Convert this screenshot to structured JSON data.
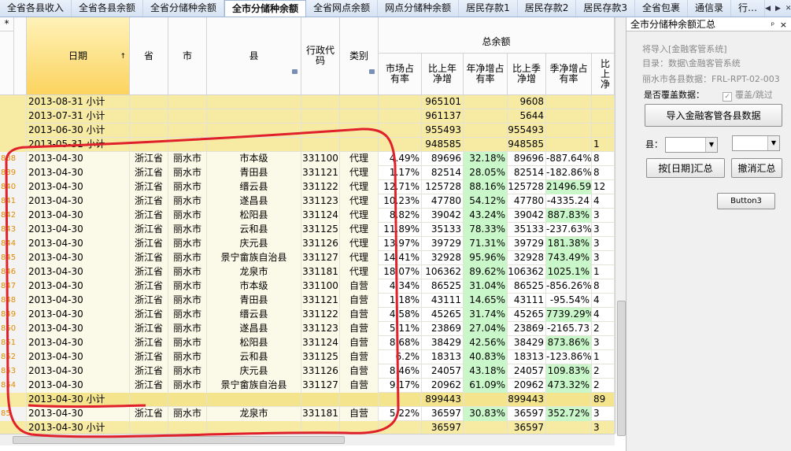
{
  "tabs": [
    "全省各县收入",
    "全省各县余额",
    "全省分储种余额",
    "全市分储种余额",
    "全省网点余额",
    "网点分储种余额",
    "居民存款1",
    "居民存款2",
    "居民存款3",
    "全省包裹",
    "通信录",
    "行…"
  ],
  "active_tab": "全市分储种余额",
  "grid": {
    "star": "*",
    "headers": {
      "date": "日期",
      "date_sort": "↑",
      "province": "省",
      "city": "市",
      "county": "县",
      "code": "行政代码",
      "type": "类别",
      "group": "总余额",
      "c1": "市场占有率",
      "c2": "比上年净增",
      "c3": "年净增占有率",
      "c4": "比上季净增",
      "c5": "季净增占有率",
      "c6": "比上净"
    },
    "rows": [
      {
        "idx": "",
        "date": "2013-08-31 小计",
        "prov": "",
        "city": "",
        "county": "",
        "code": "",
        "type": "",
        "c1": "",
        "c2": "965101",
        "c3": "",
        "c4": "9608",
        "c5": "",
        "c6": "",
        "kind": "sub"
      },
      {
        "idx": "",
        "date": "2013-07-31 小计",
        "prov": "",
        "city": "",
        "county": "",
        "code": "",
        "type": "",
        "c1": "",
        "c2": "961137",
        "c3": "",
        "c4": "5644",
        "c5": "",
        "c6": "",
        "kind": "sub"
      },
      {
        "idx": "",
        "date": "2013-06-30 小计",
        "prov": "",
        "city": "",
        "county": "",
        "code": "",
        "type": "",
        "c1": "",
        "c2": "955493",
        "c3": "",
        "c4": "955493",
        "c5": "",
        "c6": "",
        "kind": "sub"
      },
      {
        "idx": "",
        "date": "2013-05-31 小计",
        "prov": "",
        "city": "",
        "county": "",
        "code": "",
        "type": "",
        "c1": "",
        "c2": "948585",
        "c3": "",
        "c4": "948585",
        "c5": "",
        "c6": "1",
        "kind": "sub"
      },
      {
        "idx": "838",
        "date": "2013-04-30",
        "prov": "浙江省",
        "city": "丽水市",
        "county": "市本级",
        "code": "331100",
        "type": "代理",
        "c1": "4.49%",
        "c2": "89696",
        "c3": "32.18%",
        "c4": "89696",
        "c5": "-887.64%",
        "c6": "8",
        "kind": "data",
        "g3": true
      },
      {
        "idx": "839",
        "date": "2013-04-30",
        "prov": "浙江省",
        "city": "丽水市",
        "county": "青田县",
        "code": "331121",
        "type": "代理",
        "c1": "1.17%",
        "c2": "82514",
        "c3": "28.05%",
        "c4": "82514",
        "c5": "-182.86%",
        "c6": "8",
        "kind": "data",
        "g3": true
      },
      {
        "idx": "840",
        "date": "2013-04-30",
        "prov": "浙江省",
        "city": "丽水市",
        "county": "缙云县",
        "code": "331122",
        "type": "代理",
        "c1": "12.71%",
        "c2": "125728",
        "c3": "88.16%",
        "c4": "125728",
        "c5": "21496.59",
        "c6": "12",
        "kind": "data",
        "g3": true,
        "g5": true
      },
      {
        "idx": "841",
        "date": "2013-04-30",
        "prov": "浙江省",
        "city": "丽水市",
        "county": "遂昌县",
        "code": "331123",
        "type": "代理",
        "c1": "10.23%",
        "c2": "47780",
        "c3": "54.12%",
        "c4": "47780",
        "c5": "-4335.24",
        "c6": "4",
        "kind": "data",
        "g3": true
      },
      {
        "idx": "842",
        "date": "2013-04-30",
        "prov": "浙江省",
        "city": "丽水市",
        "county": "松阳县",
        "code": "331124",
        "type": "代理",
        "c1": "8.82%",
        "c2": "39042",
        "c3": "43.24%",
        "c4": "39042",
        "c5": "887.83%",
        "c6": "3",
        "kind": "data",
        "g3": true,
        "g5": true
      },
      {
        "idx": "843",
        "date": "2013-04-30",
        "prov": "浙江省",
        "city": "丽水市",
        "county": "云和县",
        "code": "331125",
        "type": "代理",
        "c1": "11.89%",
        "c2": "35133",
        "c3": "78.33%",
        "c4": "35133",
        "c5": "-237.63%",
        "c6": "3",
        "kind": "data",
        "g3": true
      },
      {
        "idx": "844",
        "date": "2013-04-30",
        "prov": "浙江省",
        "city": "丽水市",
        "county": "庆元县",
        "code": "331126",
        "type": "代理",
        "c1": "13.97%",
        "c2": "39729",
        "c3": "71.31%",
        "c4": "39729",
        "c5": "181.38%",
        "c6": "3",
        "kind": "data",
        "g3": true,
        "g5": true
      },
      {
        "idx": "845",
        "date": "2013-04-30",
        "prov": "浙江省",
        "city": "丽水市",
        "county": "景宁畲族自治县",
        "code": "331127",
        "type": "代理",
        "c1": "14.41%",
        "c2": "32928",
        "c3": "95.96%",
        "c4": "32928",
        "c5": "743.49%",
        "c6": "3",
        "kind": "data",
        "g3": true,
        "g5": true
      },
      {
        "idx": "846",
        "date": "2013-04-30",
        "prov": "浙江省",
        "city": "丽水市",
        "county": "龙泉市",
        "code": "331181",
        "type": "代理",
        "c1": "18.07%",
        "c2": "106362",
        "c3": "89.62%",
        "c4": "106362",
        "c5": "1025.1%",
        "c6": "1",
        "kind": "data",
        "g3": true,
        "g5": true
      },
      {
        "idx": "847",
        "date": "2013-04-30",
        "prov": "浙江省",
        "city": "丽水市",
        "county": "市本级",
        "code": "331100",
        "type": "自营",
        "c1": "4.34%",
        "c2": "86525",
        "c3": "31.04%",
        "c4": "86525",
        "c5": "-856.26%",
        "c6": "8",
        "kind": "data",
        "g3": true
      },
      {
        "idx": "848",
        "date": "2013-04-30",
        "prov": "浙江省",
        "city": "丽水市",
        "county": "青田县",
        "code": "331121",
        "type": "自营",
        "c1": "1.18%",
        "c2": "43111",
        "c3": "14.65%",
        "c4": "43111",
        "c5": "-95.54%",
        "c6": "4",
        "kind": "data",
        "g3": true
      },
      {
        "idx": "849",
        "date": "2013-04-30",
        "prov": "浙江省",
        "city": "丽水市",
        "county": "缙云县",
        "code": "331122",
        "type": "自营",
        "c1": "4.58%",
        "c2": "45265",
        "c3": "31.74%",
        "c4": "45265",
        "c5": "7739.29%",
        "c6": "4",
        "kind": "data",
        "g3": true,
        "g5": true
      },
      {
        "idx": "850",
        "date": "2013-04-30",
        "prov": "浙江省",
        "city": "丽水市",
        "county": "遂昌县",
        "code": "331123",
        "type": "自营",
        "c1": "5.11%",
        "c2": "23869",
        "c3": "27.04%",
        "c4": "23869",
        "c5": "-2165.73",
        "c6": "2",
        "kind": "data",
        "g3": true
      },
      {
        "idx": "851",
        "date": "2013-04-30",
        "prov": "浙江省",
        "city": "丽水市",
        "county": "松阳县",
        "code": "331124",
        "type": "自营",
        "c1": "8.68%",
        "c2": "38429",
        "c3": "42.56%",
        "c4": "38429",
        "c5": "873.86%",
        "c6": "3",
        "kind": "data",
        "g3": true,
        "g5": true
      },
      {
        "idx": "852",
        "date": "2013-04-30",
        "prov": "浙江省",
        "city": "丽水市",
        "county": "云和县",
        "code": "331125",
        "type": "自营",
        "c1": "6.2%",
        "c2": "18313",
        "c3": "40.83%",
        "c4": "18313",
        "c5": "-123.86%",
        "c6": "1",
        "kind": "data",
        "g3": true
      },
      {
        "idx": "853",
        "date": "2013-04-30",
        "prov": "浙江省",
        "city": "丽水市",
        "county": "庆元县",
        "code": "331126",
        "type": "自营",
        "c1": "8.46%",
        "c2": "24057",
        "c3": "43.18%",
        "c4": "24057",
        "c5": "109.83%",
        "c6": "2",
        "kind": "data",
        "g3": true,
        "g5": true
      },
      {
        "idx": "854",
        "date": "2013-04-30",
        "prov": "浙江省",
        "city": "丽水市",
        "county": "景宁畲族自治县",
        "code": "331127",
        "type": "自营",
        "c1": "9.17%",
        "c2": "20962",
        "c3": "61.09%",
        "c4": "20962",
        "c5": "473.32%",
        "c6": "2",
        "kind": "data",
        "g3": true,
        "g5": true
      },
      {
        "idx": "",
        "date": "2013-04-30 小计",
        "prov": "",
        "city": "",
        "county": "",
        "code": "",
        "type": "",
        "c1": "",
        "c2": "899443",
        "c3": "",
        "c4": "899443",
        "c5": "",
        "c6": "89",
        "kind": "hl"
      },
      {
        "idx": "85",
        "date": "2013-04-30",
        "prov": "浙江省",
        "city": "丽水市",
        "county": "龙泉市",
        "code": "331181",
        "type": "自营",
        "c1": "5.22%",
        "c2": "36597",
        "c3": "30.83%",
        "c4": "36597",
        "c5": "352.72%",
        "c6": "3",
        "kind": "data",
        "g3": true,
        "g5": true
      },
      {
        "idx": "",
        "date": "2013-04-30 小计",
        "prov": "",
        "city": "",
        "county": "",
        "code": "",
        "type": "",
        "c1": "",
        "c2": "36597",
        "c3": "",
        "c4": "36597",
        "c5": "",
        "c6": "3",
        "kind": "sub"
      }
    ]
  },
  "panel": {
    "title": "全市分储种余额汇总",
    "pin": "ᵖ",
    "close": "×",
    "info1": "将导入[金融客管系统]",
    "info2": "目录：数据\\金融客管系统",
    "info3": "丽水市各县数据：FRL-RPT-02-003",
    "overwrite_label": "是否覆盖数据：",
    "overwrite_check": "覆盖/跳过",
    "import_btn": "导入金融客管各县数据",
    "county_label": "县：",
    "sum_btn": "按[日期]汇总",
    "cancel_btn": "撤消汇总",
    "button3": "Button3"
  },
  "colors": {
    "accent_annot": "#e0202a",
    "subtotal": "#f7eaa2",
    "green": "#c9f7c9"
  }
}
